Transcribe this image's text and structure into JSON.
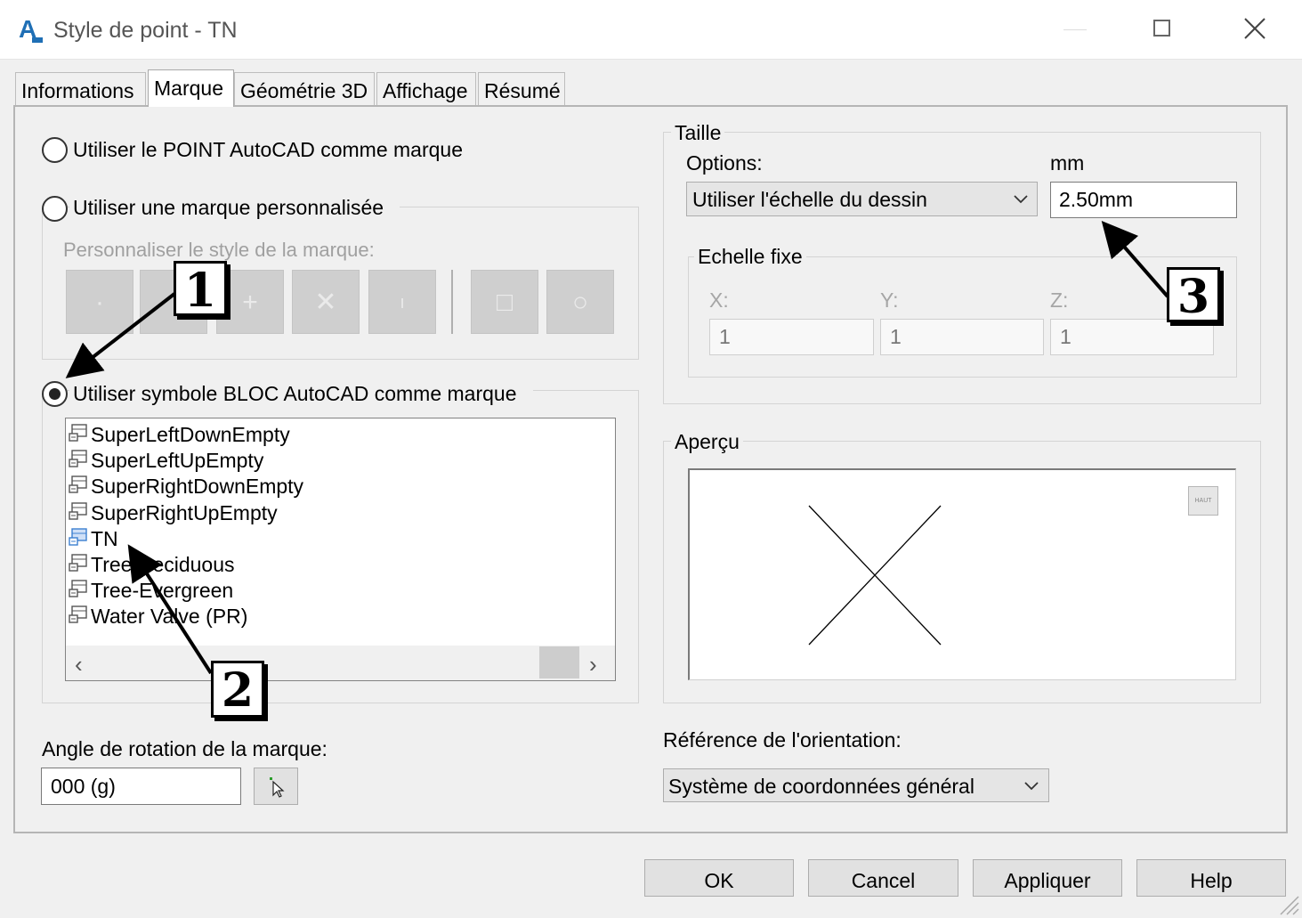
{
  "window": {
    "title": "Style de point - TN",
    "app_icon_letter": "A"
  },
  "tabs": [
    {
      "label": "Informations",
      "active": false
    },
    {
      "label": "Marque",
      "active": true
    },
    {
      "label": "Géométrie 3D",
      "active": false
    },
    {
      "label": "Affichage",
      "active": false
    },
    {
      "label": "Résumé",
      "active": false
    }
  ],
  "marker": {
    "option_point": "Utiliser le POINT AutoCAD comme marque",
    "option_custom": "Utiliser une marque personnalisée",
    "custom_style_label": "Personnaliser le style de la marque:",
    "option_block": "Utiliser symbole BLOC AutoCAD comme marque",
    "selected_option": "block",
    "custom_symbols": [
      "dot-icon",
      "none-icon",
      "plus-icon",
      "cross-icon",
      "tick-icon",
      "square-icon",
      "circle-icon"
    ],
    "block_list": [
      "SuperLeftDownEmpty",
      "SuperLeftUpEmpty",
      "SuperRightDownEmpty",
      "SuperRightUpEmpty",
      "TN",
      "Tree Deciduous",
      "Tree-Evergreen",
      "Water Valve (PR)"
    ],
    "selected_block": "TN",
    "rotation_label": "Angle de rotation de la marque:",
    "rotation_value": "000 (g)"
  },
  "size": {
    "group_title": "Taille",
    "options_label": "Options:",
    "options_value": "Utiliser l'échelle du dessin",
    "unit_label": "mm",
    "size_value": "2.50mm",
    "fixed_scale_title": "Echelle fixe",
    "x_label": "X:",
    "y_label": "Y:",
    "z_label": "Z:",
    "x_value": "1",
    "y_value": "1",
    "z_value": "1"
  },
  "preview": {
    "group_title": "Aperçu",
    "badge": "HAUT"
  },
  "orientation": {
    "label": "Référence de l'orientation:",
    "value": "Système de coordonnées général"
  },
  "buttons": {
    "ok": "OK",
    "cancel": "Cancel",
    "apply": "Appliquer",
    "help": "Help"
  },
  "callouts": [
    "1",
    "2",
    "3"
  ],
  "colors": {
    "accent": "#1f6fb5",
    "selected_icon": "#3c7fd0"
  }
}
